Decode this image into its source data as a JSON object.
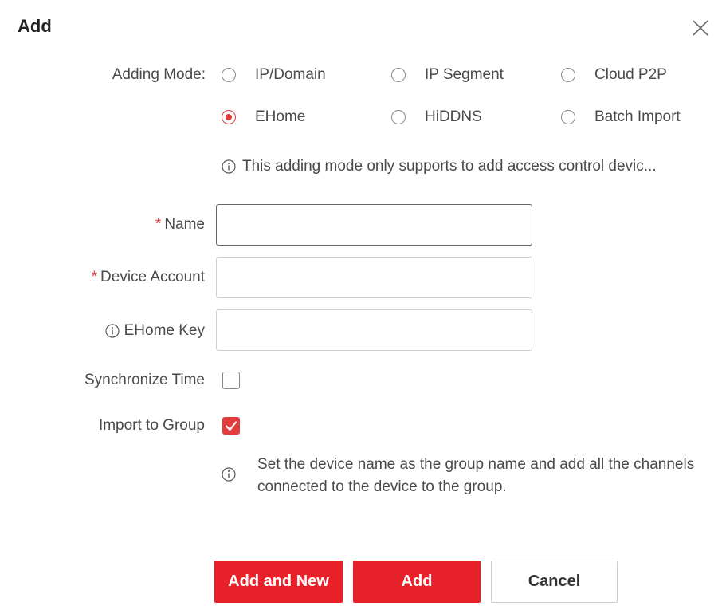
{
  "dialog": {
    "title": "Add",
    "close_icon": "close-icon"
  },
  "adding_mode": {
    "label": "Adding Mode:",
    "options": [
      {
        "label": "IP/Domain",
        "checked": false
      },
      {
        "label": "IP Segment",
        "checked": false
      },
      {
        "label": "Cloud P2P",
        "checked": false
      },
      {
        "label": "EHome",
        "checked": true
      },
      {
        "label": "HiDDNS",
        "checked": false
      },
      {
        "label": "Batch Import",
        "checked": false
      }
    ],
    "note": "This adding mode only supports to add access control devic..."
  },
  "fields": {
    "name": {
      "label": "Name",
      "required_mark": "*",
      "value": ""
    },
    "device_account": {
      "label": "Device Account",
      "required_mark": "*",
      "value": ""
    },
    "ehome_key": {
      "label": "EHome Key",
      "value": ""
    }
  },
  "options": {
    "synchronize_time": {
      "label": "Synchronize Time",
      "checked": false
    },
    "import_to_group": {
      "label": "Import to Group",
      "checked": true
    },
    "group_note": "Set the device name as the group name and add all the channels connected to the device to the group."
  },
  "buttons": {
    "add_and_new": "Add and New",
    "add": "Add",
    "cancel": "Cancel"
  },
  "colors": {
    "accent": "#e8202a",
    "radio_checked": "#e23c3c"
  }
}
